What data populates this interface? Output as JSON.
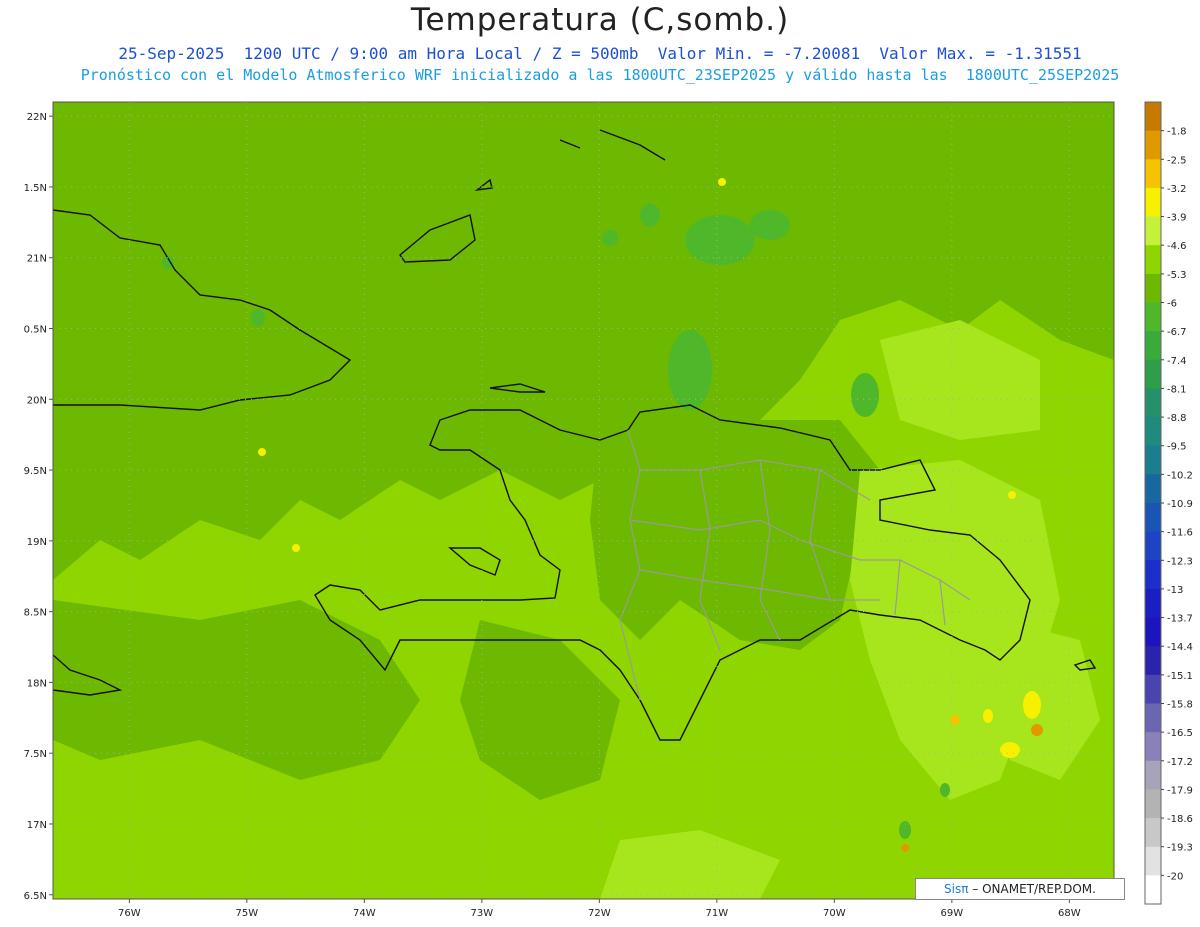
{
  "header": {
    "title": "Temperatura (C,somb.)",
    "line1": "25-Sep-2025  1200 UTC / 9:00 am Hora Local / Z = 500mb  Valor Min. = -7.20081  Valor Max. = -1.31551",
    "line2": "Pronóstico con el Modelo Atmosferico WRF inicializado a las 1800UTC_23SEP2025 y válido hasta las  1800UTC_25SEP2025"
  },
  "map": {
    "lon_range": [
      -76.65,
      -67.62
    ],
    "lat_range": [
      16.47,
      22.1
    ],
    "lat_labels": [
      {
        "value": 22.0,
        "text": "22N"
      },
      {
        "value": 21.5,
        "text": "1.5N"
      },
      {
        "value": 21.0,
        "text": "21N"
      },
      {
        "value": 20.5,
        "text": "0.5N"
      },
      {
        "value": 20.0,
        "text": "20N"
      },
      {
        "value": 19.5,
        "text": "9.5N"
      },
      {
        "value": 19.0,
        "text": "19N"
      },
      {
        "value": 18.5,
        "text": "8.5N"
      },
      {
        "value": 18.0,
        "text": "18N"
      },
      {
        "value": 17.5,
        "text": "7.5N"
      },
      {
        "value": 17.0,
        "text": "17N"
      },
      {
        "value": 16.5,
        "text": "6.5N"
      }
    ],
    "lon_labels": [
      {
        "value": -76,
        "text": "76W"
      },
      {
        "value": -75,
        "text": "75W"
      },
      {
        "value": -74,
        "text": "74W"
      },
      {
        "value": -73,
        "text": "73W"
      },
      {
        "value": -72,
        "text": "72W"
      },
      {
        "value": -71,
        "text": "71W"
      },
      {
        "value": -70,
        "text": "70W"
      },
      {
        "value": -69,
        "text": "69W"
      },
      {
        "value": -68,
        "text": "68W"
      }
    ]
  },
  "colorbar": {
    "labels": [
      "-1.8",
      "-2.5",
      "-3.2",
      "-3.9",
      "-4.6",
      "-5.3",
      "-6",
      "-6.7",
      "-7.4",
      "-8.1",
      "-8.8",
      "-9.5",
      "-10.2",
      "-10.9",
      "-11.6",
      "-12.3",
      "-13",
      "-13.7",
      "-14.4",
      "-15.1",
      "-15.8",
      "-16.5",
      "-17.2",
      "-17.9",
      "-18.6",
      "-19.3",
      "-20"
    ],
    "colors": [
      "#c67a00",
      "#e09a00",
      "#f5c400",
      "#f7f000",
      "#c4f23a",
      "#8fd500",
      "#6db800",
      "#4fb82a",
      "#3aaa3a",
      "#2e9e48",
      "#26906a",
      "#1f8a7e",
      "#1a7e8e",
      "#1868a0",
      "#1a55b4",
      "#1e44c4",
      "#1c2fc8",
      "#1a1fc2",
      "#1c14bc",
      "#2a24ad",
      "#4a45ae",
      "#6a66b0",
      "#8a80ba",
      "#a8a3b8",
      "#b3b3b3",
      "#c8c8c8",
      "#e2e2e2",
      "#ffffff"
    ]
  },
  "credit": {
    "brand": "Sisπ",
    "text": " – ONAMET/REP.DOM."
  }
}
